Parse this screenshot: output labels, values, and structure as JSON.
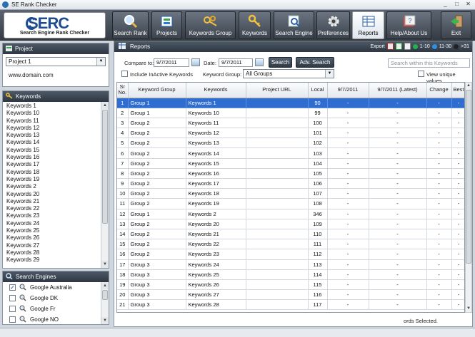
{
  "window": {
    "title": "SE Rank Checker",
    "controls": [
      "_",
      "□",
      "✕"
    ]
  },
  "logo": {
    "brand": "SERC",
    "tagline": "Search Engine Rank Checker"
  },
  "toolbar": {
    "buttons": [
      {
        "label": "Search Rank",
        "icon": "magnifier-icon",
        "active": false
      },
      {
        "label": "Projects",
        "icon": "projects-icon",
        "active": false
      },
      {
        "label": "Keywords Group",
        "icon": "keywords-group-icon",
        "active": false
      },
      {
        "label": "Keywords",
        "icon": "key-icon",
        "active": false
      },
      {
        "label": "Search Engine",
        "icon": "search-engine-icon",
        "active": false
      },
      {
        "label": "Preferences",
        "icon": "gear-icon",
        "active": false
      },
      {
        "label": "Reports",
        "icon": "reports-icon",
        "active": true
      },
      {
        "label": "Help/About Us",
        "icon": "help-icon",
        "active": false
      },
      {
        "label": "Exit",
        "icon": "exit-icon",
        "active": false
      }
    ]
  },
  "project_panel": {
    "title": "Project",
    "selected": "Project 1",
    "domain": "www.domain.com"
  },
  "keywords_panel": {
    "title": "Keywords",
    "items": [
      "Keywords 1",
      "Keywords 10",
      "Keywords 11",
      "Keywords 12",
      "Keywords 13",
      "Keywords 14",
      "Keywords 15",
      "Keywords 16",
      "Keywords 17",
      "Keywords 18",
      "Keywords 19",
      "Keywords 2",
      "Keywords 20",
      "Keywords 21",
      "Keywords 22",
      "Keywords 23",
      "Keywords 24",
      "Keywords 25",
      "Keywords 26",
      "Keywords 27",
      "Keywords 28",
      "Keywords 29"
    ]
  },
  "engines_panel": {
    "title": "Search Engines",
    "items": [
      {
        "label": "Google Australia",
        "checked": true
      },
      {
        "label": "Google DK",
        "checked": false
      },
      {
        "label": "Google Fr",
        "checked": false
      },
      {
        "label": "Google NO",
        "checked": false
      }
    ]
  },
  "reports": {
    "title": "Reports",
    "export_label": "Export",
    "legend": [
      {
        "label": "1-10",
        "color": "#22b14c"
      },
      {
        "label": "11-30",
        "color": "#2f8fe0"
      },
      {
        "label": ">31",
        "color": "#222222"
      }
    ],
    "compare_label": "Compare to:",
    "compare_date": "9/7/2011",
    "date_label": "Date:",
    "date_value": "9/7/2011",
    "search_button": "Search",
    "adv_search_button": "Adv. Search",
    "search_placeholder": "Search within this Keywords",
    "include_inactive": "Include InActive Keywords",
    "group_label": "Keyword Group:",
    "group_value": "All Groups",
    "view_unique": "View unique values",
    "status_text": "ords Selected."
  },
  "table": {
    "columns": [
      "Sr No.",
      "Keyword Group",
      "Keywords",
      "Project URL",
      "Local",
      "9/7/2011",
      "9/7/2011 (Latest)",
      "Change",
      "Best"
    ],
    "rows": [
      [
        "1",
        "Group 1",
        "Keywords 1",
        "",
        "90",
        "-",
        "-",
        "-",
        "-"
      ],
      [
        "2",
        "Group 1",
        "Keywords 10",
        "",
        "99",
        "-",
        "-",
        "-",
        "-"
      ],
      [
        "3",
        "Group 2",
        "Keywords 11",
        "",
        "100",
        "-",
        "-",
        "-",
        "-"
      ],
      [
        "4",
        "Group 2",
        "Keywords 12",
        "",
        "101",
        "-",
        "-",
        "-",
        "-"
      ],
      [
        "5",
        "Group 2",
        "Keywords 13",
        "",
        "102",
        "-",
        "-",
        "-",
        "-"
      ],
      [
        "6",
        "Group 2",
        "Keywords 14",
        "",
        "103",
        "-",
        "-",
        "-",
        "-"
      ],
      [
        "7",
        "Group 2",
        "Keywords 15",
        "",
        "104",
        "-",
        "-",
        "-",
        "-"
      ],
      [
        "8",
        "Group 2",
        "Keywords 16",
        "",
        "105",
        "-",
        "-",
        "-",
        "-"
      ],
      [
        "9",
        "Group 2",
        "Keywords 17",
        "",
        "106",
        "-",
        "-",
        "-",
        "-"
      ],
      [
        "10",
        "Group 2",
        "Keywords 18",
        "",
        "107",
        "-",
        "-",
        "-",
        "-"
      ],
      [
        "11",
        "Group 2",
        "Keywords 19",
        "",
        "108",
        "-",
        "-",
        "-",
        "-"
      ],
      [
        "12",
        "Group 1",
        "Keywords 2",
        "",
        "346",
        "-",
        "-",
        "-",
        "-"
      ],
      [
        "13",
        "Group 2",
        "Keywords 20",
        "",
        "109",
        "-",
        "-",
        "-",
        "-"
      ],
      [
        "14",
        "Group 2",
        "Keywords 21",
        "",
        "110",
        "-",
        "-",
        "-",
        "-"
      ],
      [
        "15",
        "Group 2",
        "Keywords 22",
        "",
        "111",
        "-",
        "-",
        "-",
        "-"
      ],
      [
        "16",
        "Group 2",
        "Keywords 23",
        "",
        "112",
        "-",
        "-",
        "-",
        "-"
      ],
      [
        "17",
        "Group 3",
        "Keywords 24",
        "",
        "113",
        "-",
        "-",
        "-",
        "-"
      ],
      [
        "18",
        "Group 3",
        "Keywords 25",
        "",
        "114",
        "-",
        "-",
        "-",
        "-"
      ],
      [
        "19",
        "Group 3",
        "Keywords 26",
        "",
        "115",
        "-",
        "-",
        "-",
        "-"
      ],
      [
        "20",
        "Group 3",
        "Keywords 27",
        "",
        "116",
        "-",
        "-",
        "-",
        "-"
      ],
      [
        "21",
        "Group 3",
        "Keywords 28",
        "",
        "117",
        "-",
        "-",
        "-",
        "-"
      ]
    ],
    "selected_row": 0
  }
}
